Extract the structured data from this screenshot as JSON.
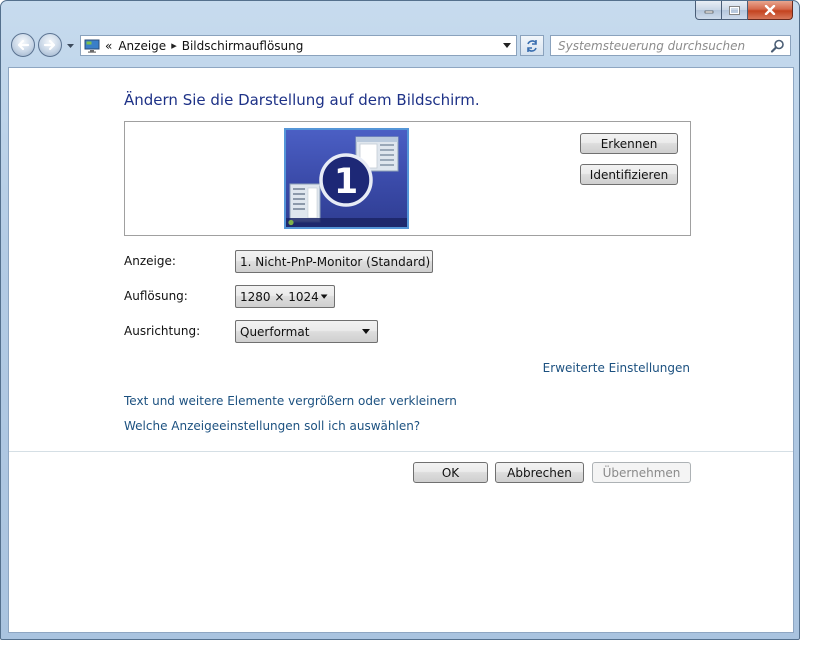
{
  "window": {
    "caption_buttons": {
      "minimize": "minimize",
      "maximize": "maximize",
      "close": "close"
    }
  },
  "navbar": {
    "address": {
      "prefix": "«",
      "crumbs": [
        "Anzeige",
        "Bildschirmauflösung"
      ],
      "separator": "▸"
    },
    "search_placeholder": "Systemsteuerung durchsuchen"
  },
  "main": {
    "heading": "Ändern Sie die Darstellung auf dem Bildschirm.",
    "monitor_number": "1",
    "buttons": {
      "detect": "Erkennen",
      "identify": "Identifizieren"
    },
    "settings": {
      "display_label": "Anzeige:",
      "display_value": "1. Nicht-PnP-Monitor (Standard)",
      "resolution_label": "Auflösung:",
      "resolution_value": "1280 × 1024",
      "orientation_label": "Ausrichtung:",
      "orientation_value": "Querformat"
    },
    "links": {
      "advanced": "Erweiterte Einstellungen",
      "text_size": "Text und weitere Elemente vergrößern oder verkleinern",
      "which_settings": "Welche Anzeigeeinstellungen soll ich auswählen?"
    },
    "footer_buttons": {
      "ok": "OK",
      "cancel": "Abbrechen",
      "apply": "Übernehmen"
    }
  },
  "colors": {
    "heading": "#1e3287",
    "link": "#1c5180",
    "monitor_fill": "#3a4aa8",
    "monitor_border": "#5596d8",
    "frame": "#b3cbe4"
  }
}
